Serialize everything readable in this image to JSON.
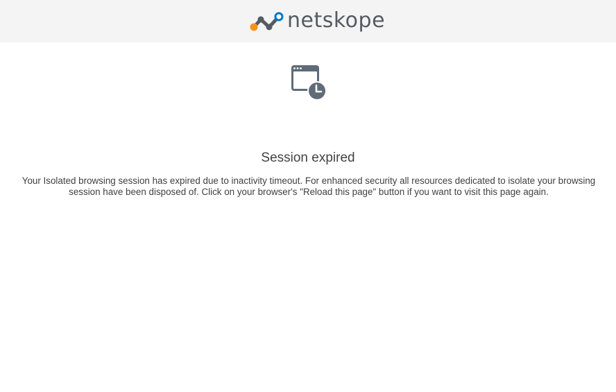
{
  "header": {
    "brand": "netskope",
    "brand_colors": {
      "orange": "#f6921e",
      "dark": "#555b63",
      "blue": "#0077c8"
    }
  },
  "content": {
    "icon": "browser-window-clock-icon",
    "title": "Session expired",
    "message": "Your Isolated browsing session has expired due to inactivity timeout. For enhanced security all resources dedicated to isolate your browsing session have been disposed of. Click on your browser's \"Reload this page\" button if you want to visit this page again."
  },
  "colors": {
    "header_bg": "#f4f4f4",
    "icon": "#5f6b78",
    "text": "#3f3f3f"
  }
}
